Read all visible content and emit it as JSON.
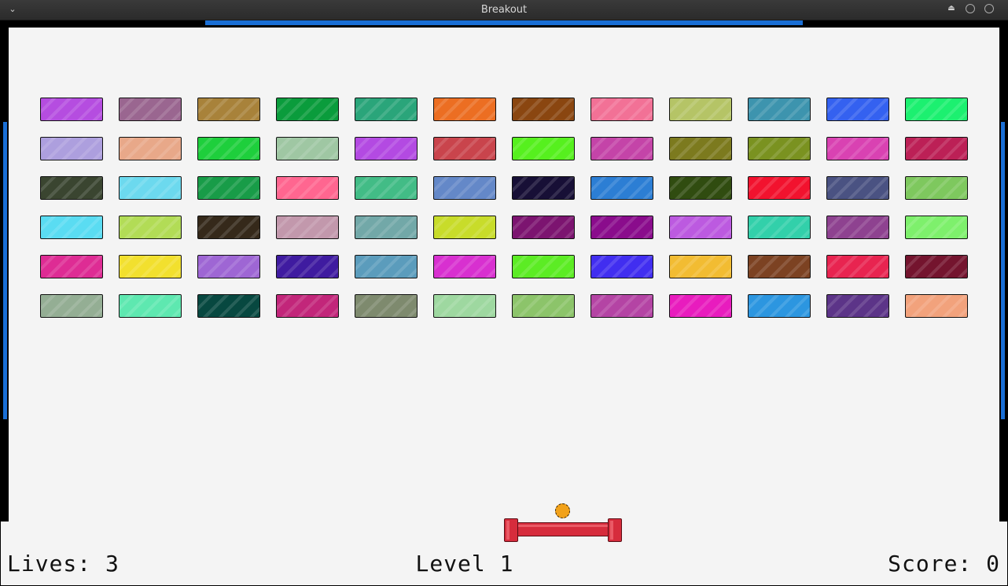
{
  "window": {
    "title": "Breakout",
    "menu_icon": "chevron-down-icon",
    "controls": [
      "eject-icon",
      "minimize-icon",
      "maximize-icon"
    ],
    "accent_color": "#1a6fd6"
  },
  "hud": {
    "lives": "Lives: 3",
    "level": "Level 1",
    "score": "Score: 0"
  },
  "game": {
    "background": "#f4f4f4",
    "paddle_color": "#d62c3c",
    "ball_color": "#f2a21a",
    "brick_rows": [
      [
        "#b54de0",
        "#9a6690",
        "#a8823a",
        "#0a9c3c",
        "#2aa57a",
        "#ec6e22",
        "#8a4610",
        "#f27196",
        "#b5c466",
        "#3d94ae",
        "#3461f0",
        "#1cf070"
      ],
      [
        "#ad9fde",
        "#e8a889",
        "#1ecf3c",
        "#9fc7a3",
        "#b34ae2",
        "#c9444c",
        "#56f01e",
        "#c444a8",
        "#7c7a1e",
        "#7a9220",
        "#d942b2",
        "#bc2056"
      ],
      [
        "#3a4530",
        "#6cd9ee",
        "#189c48",
        "#ff6690",
        "#42bc86",
        "#6488c8",
        "#170f36",
        "#2c7ed4",
        "#304c10",
        "#f2122e",
        "#4a5282",
        "#7ec85e"
      ],
      [
        "#5adcf2",
        "#b2dc56",
        "#35291a",
        "#c298ac",
        "#72a8a8",
        "#c8dc2a",
        "#7c1470",
        "#8a0c8c",
        "#bc5ae0",
        "#32d0aa",
        "#8e4290",
        "#7ef06c"
      ],
      [
        "#de2c94",
        "#f2e02e",
        "#9e66d4",
        "#3f1ba0",
        "#5b9cbc",
        "#d830d0",
        "#5cec24",
        "#412ef0",
        "#f2bc32",
        "#7c4222",
        "#e82450",
        "#74142e"
      ],
      [
        "#94ae94",
        "#5ee8b0",
        "#074840",
        "#c2267a",
        "#7e8a6e",
        "#9ed8a0",
        "#8cc46a",
        "#b444a4",
        "#e81cbe",
        "#2c96e0",
        "#5c3488",
        "#f2a27c"
      ]
    ]
  }
}
